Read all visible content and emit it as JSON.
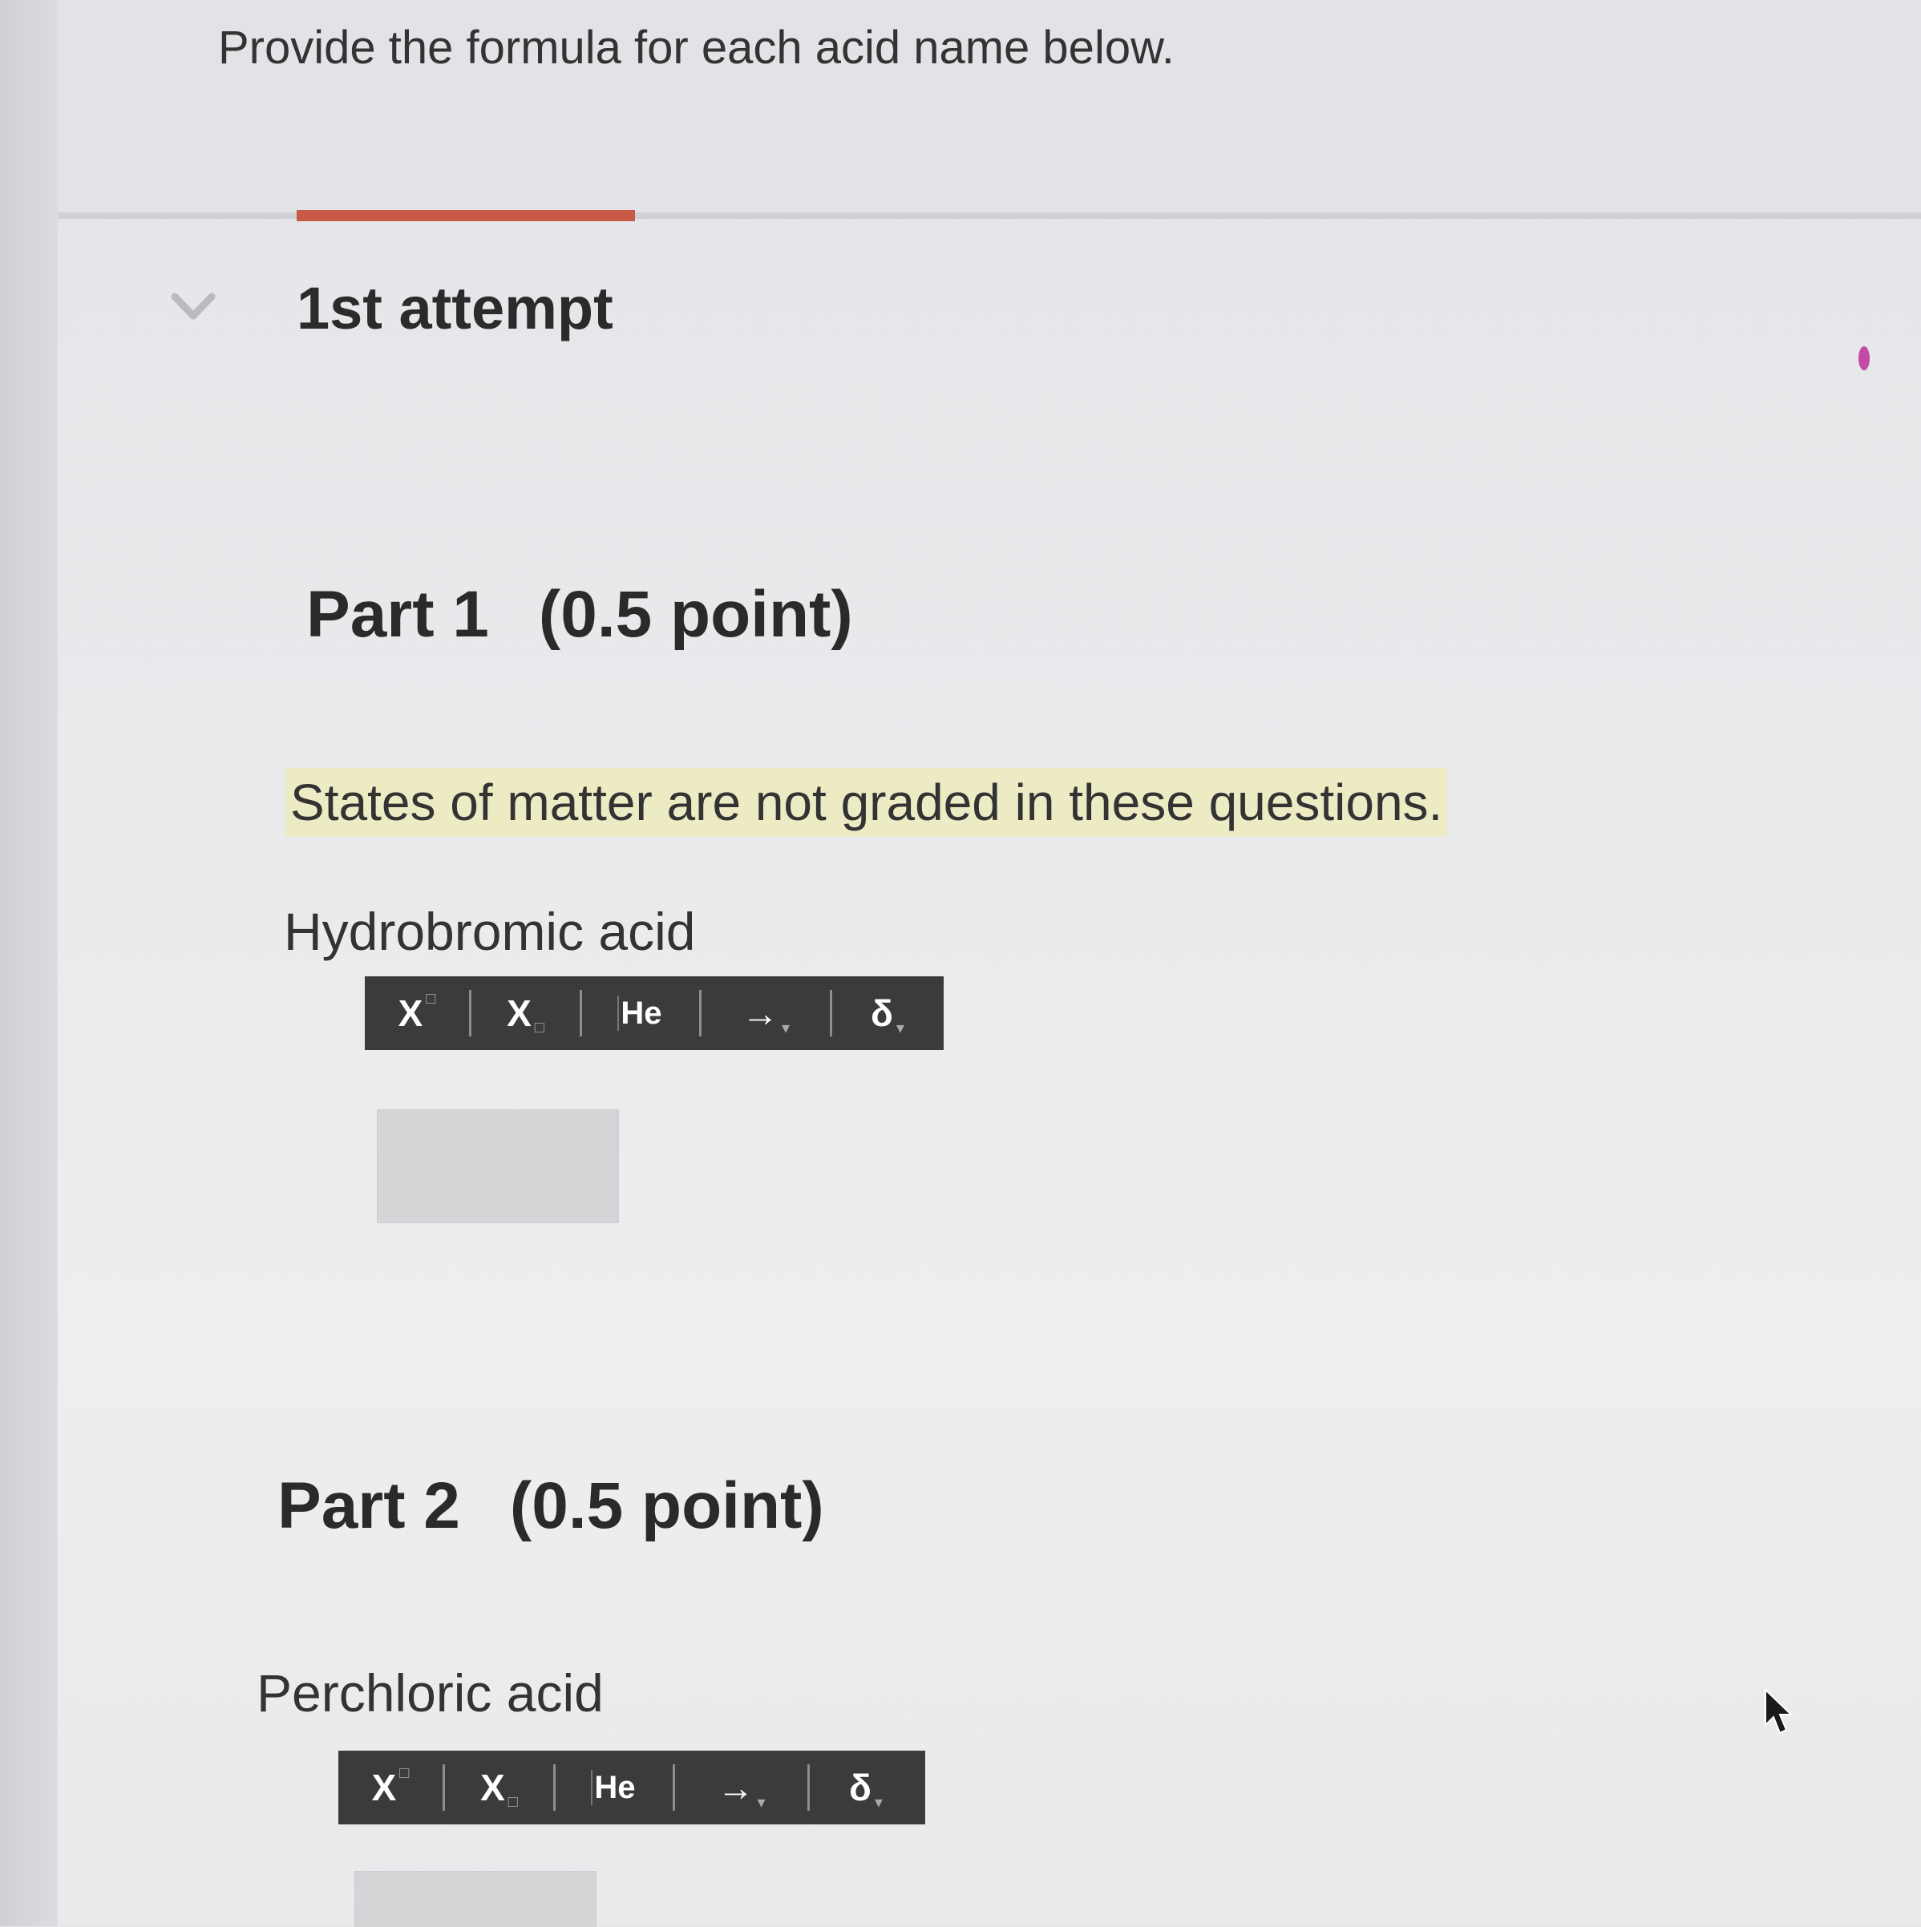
{
  "instructions": "Provide the formula for each acid name below.",
  "attempt": {
    "title": "1st attempt",
    "progress_fraction": 0.125
  },
  "parts": [
    {
      "title": "Part 1",
      "points": "(0.5 point)",
      "notice": "States of matter are not graded in these questions.",
      "acid_name": "Hydrobromic acid",
      "answer_value": ""
    },
    {
      "title": "Part 2",
      "points": "(0.5 point)",
      "acid_name": "Perchloric acid",
      "answer_value": ""
    }
  ],
  "toolbar": {
    "superscript_label": "X",
    "subscript_label": "X",
    "element_label": "He",
    "arrow_label": "→",
    "delta_label": "δ"
  },
  "icons": {
    "collapse": "chevron-down-icon",
    "cursor": "mouse-pointer-icon"
  },
  "colors": {
    "progress": "#c75a45",
    "highlight": "#ecebc4",
    "toolbar_bg": "#3a3b3d"
  }
}
